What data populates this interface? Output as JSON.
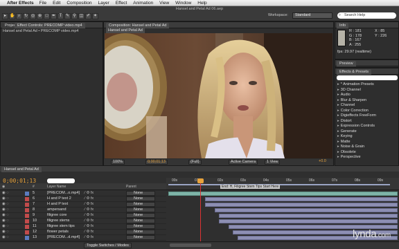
{
  "menubar": {
    "app_name": "After Effects",
    "items": [
      "File",
      "Edit",
      "Composition",
      "Layer",
      "Effect",
      "Animation",
      "View",
      "Window",
      "Help"
    ]
  },
  "window": {
    "title": "Hansel and Petal Ad 06.aep"
  },
  "toolbar": {
    "workspace_label": "Workspace:",
    "workspace_value": "Standard",
    "search_placeholder": "Search Help"
  },
  "project_panel": {
    "tab_label": "Project",
    "breadcrumb": "Hansel and Petal Ad • PRECOMP video.mp4"
  },
  "effect_controls": {
    "tab_label": "Effect Controls: PRECOMP video.mp4"
  },
  "comp_panel": {
    "tab_label": "Composition: Hansel and Petal Ad",
    "sub_tab": "Hansel and Petal Ad",
    "zoom": "100%",
    "timecode": "0;00;01;13",
    "resolution": "(Full)",
    "camera": "Active Camera",
    "views": "1 View",
    "exposure": "+0.0"
  },
  "info_panel": {
    "tab_label": "Info",
    "r": "R : 181",
    "g": "G : 178",
    "b": "B : 167",
    "a": "A : 255",
    "x": "X : 85",
    "y": "Y : 226",
    "fps": "fps: 29.97 (realtime)"
  },
  "preview_panel": {
    "tab_label": "Preview"
  },
  "effects_panel": {
    "tab_label": "Effects & Presets",
    "items": [
      "* Animation Presets",
      "3D Channel",
      "Audio",
      "Blur & Sharpen",
      "Channel",
      "Color Correction",
      "Digieffects FreeForm",
      "Distort",
      "Expression Controls",
      "Generate",
      "Keying",
      "Matte",
      "Noise & Grain",
      "Obsolete",
      "Perspective"
    ]
  },
  "timeline": {
    "tab_label": "Hansel and Petal Ad",
    "timecode": "0;00;01;13",
    "col_layer_name": "Layer Name",
    "col_parent": "Parent",
    "marker_text": "End: H, Filigree Stem Tips Start Here",
    "ruler_labels": [
      "00s",
      "01s",
      "02s",
      "03s",
      "04s",
      "05s",
      "06s",
      "07s",
      "08s",
      "09s",
      "10s"
    ],
    "toggle_label": "Toggle Switches / Modes",
    "layers": [
      {
        "num": "5",
        "name": "[PRECOM...o.mp4]",
        "parent": "None",
        "color": "#5b7cbf",
        "start": 0.0,
        "end": 1.0
      },
      {
        "num": "6",
        "name": "H and P text 2",
        "parent": "None",
        "color": "#c24b4b",
        "start": 0.16,
        "end": 1.0
      },
      {
        "num": "7",
        "name": "H and P text",
        "parent": "None",
        "color": "#c24b4b",
        "start": 0.16,
        "end": 1.0
      },
      {
        "num": "8",
        "name": "ampersand",
        "parent": "None",
        "color": "#c24b4b",
        "start": 0.2,
        "end": 1.0
      },
      {
        "num": "9",
        "name": "filigree core",
        "parent": "None",
        "color": "#c24b4b",
        "start": 0.22,
        "end": 1.0
      },
      {
        "num": "10",
        "name": "filigree stems",
        "parent": "None",
        "color": "#c24b4b",
        "start": 0.22,
        "end": 1.0
      },
      {
        "num": "11",
        "name": "filigree stem tips",
        "parent": "None",
        "color": "#c24b4b",
        "start": 0.26,
        "end": 1.0
      },
      {
        "num": "12",
        "name": "flower petals",
        "parent": "None",
        "color": "#c24b4b",
        "start": 0.28,
        "end": 1.0
      },
      {
        "num": "13",
        "name": "[PRECOM...d.mp4]",
        "parent": "None",
        "color": "#5b7cbf",
        "start": 0.3,
        "end": 1.0
      }
    ]
  },
  "watermark": {
    "text": "lynda",
    "suffix": ".com"
  },
  "colors": {
    "timecode": "#e8a33c",
    "playhead": "#dd3333",
    "layer_bar": "#8d8fb3",
    "video_bar": "#7fb4a8"
  }
}
